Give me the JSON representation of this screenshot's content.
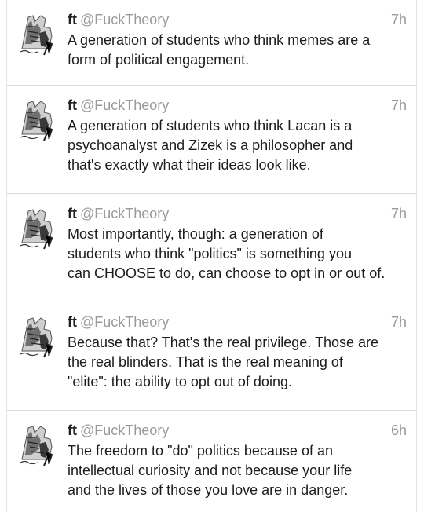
{
  "tweets": [
    {
      "name": "ft",
      "handle": "@FuckTheory",
      "time": "7h",
      "text": "A generation of students who think memes are a\nform of political engagement."
    },
    {
      "name": "ft",
      "handle": "@FuckTheory",
      "time": "7h",
      "text": "A generation of students who think Lacan is a\npsychoanalyst and Zizek is a philosopher and\nthat's exactly what their ideas look like."
    },
    {
      "name": "ft",
      "handle": "@FuckTheory",
      "time": "7h",
      "text": "Most importantly, though: a generation of\nstudents who think \"politics\" is something you\ncan CHOOSE to do, can choose to opt in or out of."
    },
    {
      "name": "ft",
      "handle": "@FuckTheory",
      "time": "7h",
      "text": "Because that? That's the real privilege. Those are\nthe real blinders. That is the real meaning of\n\"elite\": the ability to opt out of doing."
    },
    {
      "name": "ft",
      "handle": "@FuckTheory",
      "time": "6h",
      "text": "The freedom to \"do\" politics because of an\nintellectual curiosity and not because your life\nand the lives of those you love are in danger."
    }
  ],
  "avatar_icon": "engraving-figures-avatar-icon"
}
